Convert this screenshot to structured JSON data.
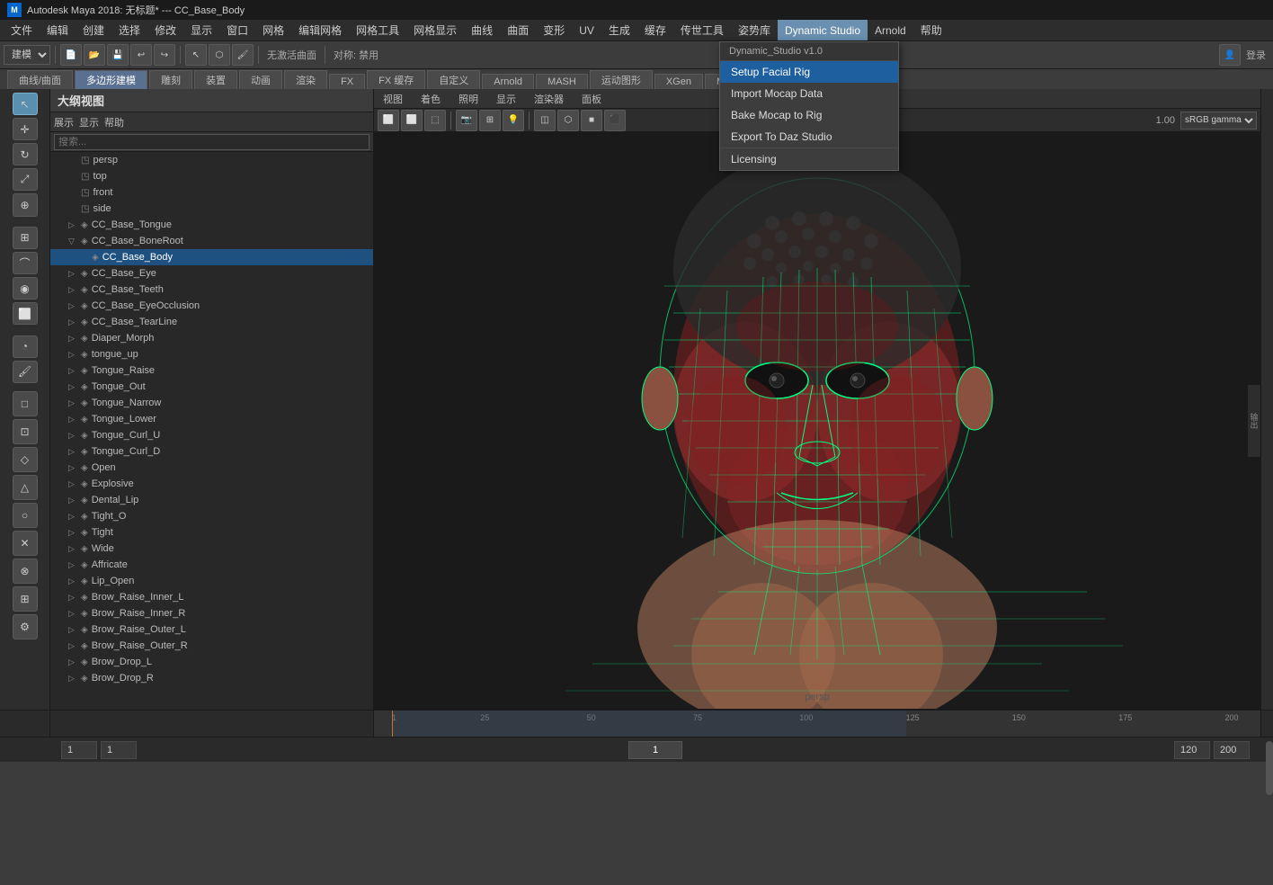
{
  "titleBar": {
    "icon": "M",
    "title": "Autodesk Maya 2018: 无标题*  ---  CC_Base_Body"
  },
  "menuBar": {
    "items": [
      {
        "id": "file",
        "label": "文件"
      },
      {
        "id": "edit",
        "label": "编辑"
      },
      {
        "id": "create",
        "label": "创建"
      },
      {
        "id": "select",
        "label": "选择"
      },
      {
        "id": "modify",
        "label": "修改"
      },
      {
        "id": "display",
        "label": "显示"
      },
      {
        "id": "window",
        "label": "窗口"
      },
      {
        "id": "mesh",
        "label": "网格"
      },
      {
        "id": "mesh-edit",
        "label": "编辑网格"
      },
      {
        "id": "mesh-tools",
        "label": "网格工具"
      },
      {
        "id": "mesh-display",
        "label": "网格显示"
      },
      {
        "id": "curves",
        "label": "曲线"
      },
      {
        "id": "surfaces",
        "label": "曲面"
      },
      {
        "id": "deform",
        "label": "变形"
      },
      {
        "id": "uv",
        "label": "UV"
      },
      {
        "id": "generate",
        "label": "生成"
      },
      {
        "id": "cache",
        "label": "缓存"
      },
      {
        "id": "xgen-tools",
        "label": "传世工具"
      },
      {
        "id": "pose-lib",
        "label": "姿势库"
      },
      {
        "id": "dynamic-studio",
        "label": "Dynamic Studio",
        "active": true
      },
      {
        "id": "arnold",
        "label": "Arnold"
      },
      {
        "id": "help",
        "label": "帮助"
      }
    ]
  },
  "toolbar": {
    "modeDropdown": "建模",
    "noActiveObject": "无激活曲面",
    "symmetry": "对称: 禁用"
  },
  "modeTabs": [
    {
      "id": "curves-surfaces",
      "label": "曲线/曲面"
    },
    {
      "id": "polygon",
      "label": "多边形建模",
      "active": true
    },
    {
      "id": "sculpt",
      "label": "雕刻"
    },
    {
      "id": "rig",
      "label": "装置"
    },
    {
      "id": "animate",
      "label": "动画"
    },
    {
      "id": "render",
      "label": "渲染"
    },
    {
      "id": "fx",
      "label": "FX"
    },
    {
      "id": "fx-cache",
      "label": "FX 缓存"
    },
    {
      "id": "custom",
      "label": "自定义"
    },
    {
      "id": "arnold-tab",
      "label": "Arnold"
    },
    {
      "id": "mash-tab",
      "label": "MASH"
    },
    {
      "id": "motion-graphics",
      "label": "运动图形"
    },
    {
      "id": "xgen-tab",
      "label": "XGen"
    },
    {
      "id": "misc",
      "label": "Misc"
    }
  ],
  "outliner": {
    "title": "大纲视图",
    "menuItems": [
      "展示",
      "显示",
      "帮助"
    ],
    "searchPlaceholder": "搜索...",
    "items": [
      {
        "id": "persp",
        "label": "persp",
        "icon": "camera",
        "indent": 1,
        "expand": false
      },
      {
        "id": "top",
        "label": "top",
        "icon": "camera",
        "indent": 1,
        "expand": false
      },
      {
        "id": "front",
        "label": "front",
        "icon": "camera",
        "indent": 1,
        "expand": false
      },
      {
        "id": "side",
        "label": "side",
        "icon": "camera",
        "indent": 1,
        "expand": false
      },
      {
        "id": "tongue",
        "label": "CC_Base_Tongue",
        "icon": "shape",
        "indent": 1,
        "expand": false
      },
      {
        "id": "boneroot",
        "label": "CC_Base_BoneRoot",
        "icon": "skeleton",
        "indent": 1,
        "expand": true
      },
      {
        "id": "body",
        "label": "CC_Base_Body",
        "icon": "shape",
        "indent": 2,
        "expand": false,
        "selected": true
      },
      {
        "id": "eye",
        "label": "CC_Base_Eye",
        "icon": "shape",
        "indent": 1
      },
      {
        "id": "teeth",
        "label": "CC_Base_Teeth",
        "icon": "shape",
        "indent": 1
      },
      {
        "id": "eyeocclusion",
        "label": "CC_Base_EyeOcclusion",
        "icon": "shape",
        "indent": 1
      },
      {
        "id": "tearline",
        "label": "CC_Base_TearLine",
        "icon": "shape",
        "indent": 1
      },
      {
        "id": "diaper",
        "label": "Diaper_Morph",
        "icon": "shape",
        "indent": 1
      },
      {
        "id": "tongue-up",
        "label": "tongue_up",
        "icon": "shape",
        "indent": 1
      },
      {
        "id": "tongue-raise",
        "label": "Tongue_Raise",
        "icon": "shape",
        "indent": 1
      },
      {
        "id": "tongue-out",
        "label": "Tongue_Out",
        "icon": "shape",
        "indent": 1
      },
      {
        "id": "tongue-narrow",
        "label": "Tongue_Narrow",
        "icon": "shape",
        "indent": 1
      },
      {
        "id": "tongue-lower",
        "label": "Tongue_Lower",
        "icon": "shape",
        "indent": 1
      },
      {
        "id": "tongue-curl-u",
        "label": "Tongue_Curl_U",
        "icon": "shape",
        "indent": 1
      },
      {
        "id": "tongue-curl-d",
        "label": "Tongue_Curl_D",
        "icon": "shape",
        "indent": 1
      },
      {
        "id": "open",
        "label": "Open",
        "icon": "shape",
        "indent": 1
      },
      {
        "id": "explosive",
        "label": "Explosive",
        "icon": "shape",
        "indent": 1
      },
      {
        "id": "dental-lip",
        "label": "Dental_Lip",
        "icon": "shape",
        "indent": 1
      },
      {
        "id": "tight-o",
        "label": "Tight_O",
        "icon": "shape",
        "indent": 1
      },
      {
        "id": "tight",
        "label": "Tight",
        "icon": "shape",
        "indent": 1
      },
      {
        "id": "wide",
        "label": "Wide",
        "icon": "shape",
        "indent": 1
      },
      {
        "id": "affricate",
        "label": "Affricate",
        "icon": "shape",
        "indent": 1
      },
      {
        "id": "lip-open",
        "label": "Lip_Open",
        "icon": "shape",
        "indent": 1
      },
      {
        "id": "brow-raise-inner-l",
        "label": "Brow_Raise_Inner_L",
        "icon": "shape",
        "indent": 1
      },
      {
        "id": "brow-raise-inner-r",
        "label": "Brow_Raise_Inner_R",
        "icon": "shape",
        "indent": 1
      },
      {
        "id": "brow-raise-outer-l",
        "label": "Brow_Raise_Outer_L",
        "icon": "shape",
        "indent": 1
      },
      {
        "id": "brow-raise-outer-r",
        "label": "Brow_Raise_Outer_R",
        "icon": "shape",
        "indent": 1
      },
      {
        "id": "brow-drop-l",
        "label": "Brow_Drop_L",
        "icon": "shape",
        "indent": 1
      },
      {
        "id": "brow-drop-r",
        "label": "Brow_Drop_R",
        "icon": "shape",
        "indent": 1
      }
    ]
  },
  "viewport": {
    "menuItems": [
      "视图",
      "着色",
      "照明",
      "显示",
      "渲染器",
      "面板"
    ],
    "perspLabel": "persp",
    "gamma": "sRGB gamma",
    "zoom": "1.00"
  },
  "dynamicStudioMenu": {
    "title": "Dynamic_Studio v1.0",
    "items": [
      {
        "id": "setup-facial-rig",
        "label": "Setup Facial Rig",
        "highlighted": true
      },
      {
        "id": "import-mocap",
        "label": "Import Mocap Data"
      },
      {
        "id": "bake-mocap",
        "label": "Bake Mocap to Rig"
      },
      {
        "id": "export-daz",
        "label": "Export To Daz Studio"
      },
      {
        "id": "separator",
        "type": "separator"
      },
      {
        "id": "licensing",
        "label": "Licensing"
      }
    ]
  },
  "timeline": {
    "start": 1,
    "end": 200,
    "current": 1,
    "rangeStart": 1,
    "rangeEnd": 120,
    "marks": [
      "1",
      "25",
      "50",
      "75",
      "100",
      "125",
      "150",
      "175",
      "200"
    ],
    "fps": "120",
    "endFrame": "200"
  },
  "statusBar": {
    "frame1": "1",
    "frame2": "1",
    "currentFrame": "1",
    "rangeEnd": "120",
    "totalEnd": "200"
  },
  "rightPanel": {
    "inputOutput": "输",
    "output": "输"
  }
}
